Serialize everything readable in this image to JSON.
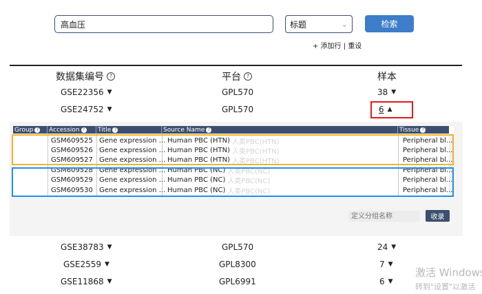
{
  "search": {
    "query": "高血压",
    "field_selected": "标题",
    "button": "检索",
    "add_row": "+ 添加行",
    "separator": "|",
    "reset": "重设"
  },
  "columns": {
    "dataset_id": "数据集编号",
    "platform": "平台",
    "sample": "样本",
    "help": "?"
  },
  "rows": [
    {
      "id": "GSE22356",
      "platform": "GPL570",
      "samples": "38"
    },
    {
      "id": "GSE24752",
      "platform": "GPL570",
      "samples": "6"
    },
    {
      "id": "GSE38783",
      "platform": "GPL570",
      "samples": "24"
    },
    {
      "id": "GSE2559",
      "platform": "GPL8300",
      "samples": "7"
    },
    {
      "id": "GSE11868",
      "platform": "GPL6991",
      "samples": "6"
    }
  ],
  "detail": {
    "headers": [
      "Group",
      "Accession",
      "Title",
      "Source Name",
      "Tissue"
    ],
    "samples": [
      {
        "accession": "GSM609525",
        "title": "Gene expression ...",
        "source": "Human PBC (HTN)",
        "source_cn": "人类PBC(HTN)",
        "tissue": "Peripheral bl..."
      },
      {
        "accession": "GSM609526",
        "title": "Gene expression ...",
        "source": "Human PBC (HTN)",
        "source_cn": "人类PBC(HTN)",
        "tissue": "Peripheral bl..."
      },
      {
        "accession": "GSM609527",
        "title": "Gene expression ...",
        "source": "Human PBC (HTN)",
        "source_cn": "人类PBC(HTN)",
        "tissue": "Peripheral bl..."
      },
      {
        "accession": "GSM609528",
        "title": "Gene expression ...",
        "source": "Human PBC (NC)",
        "source_cn": "人类PBC(NC)",
        "tissue": "Peripheral bl..."
      },
      {
        "accession": "GSM609529",
        "title": "Gene expression ...",
        "source": "Human PBC (NC)",
        "source_cn": "人类PBC(NC)",
        "tissue": "Peripheral bl..."
      },
      {
        "accession": "GSM609530",
        "title": "Gene expression ...",
        "source": "Human PBC (NC)",
        "source_cn": "人类PBC(NC)",
        "tissue": "Peripheral bl..."
      }
    ],
    "group_name_placeholder": "定义分组名称",
    "collapse_button": "收录"
  },
  "watermark": {
    "title": "激活 Windows",
    "subtitle": "转到\"设置\"以激活"
  },
  "colors": {
    "header_dark": "#3d4f6e",
    "accent_blue": "#3d7dc9",
    "group_htn": "#f2b324",
    "group_nc": "#1e8fe8",
    "highlight_red": "#e01a1a"
  }
}
